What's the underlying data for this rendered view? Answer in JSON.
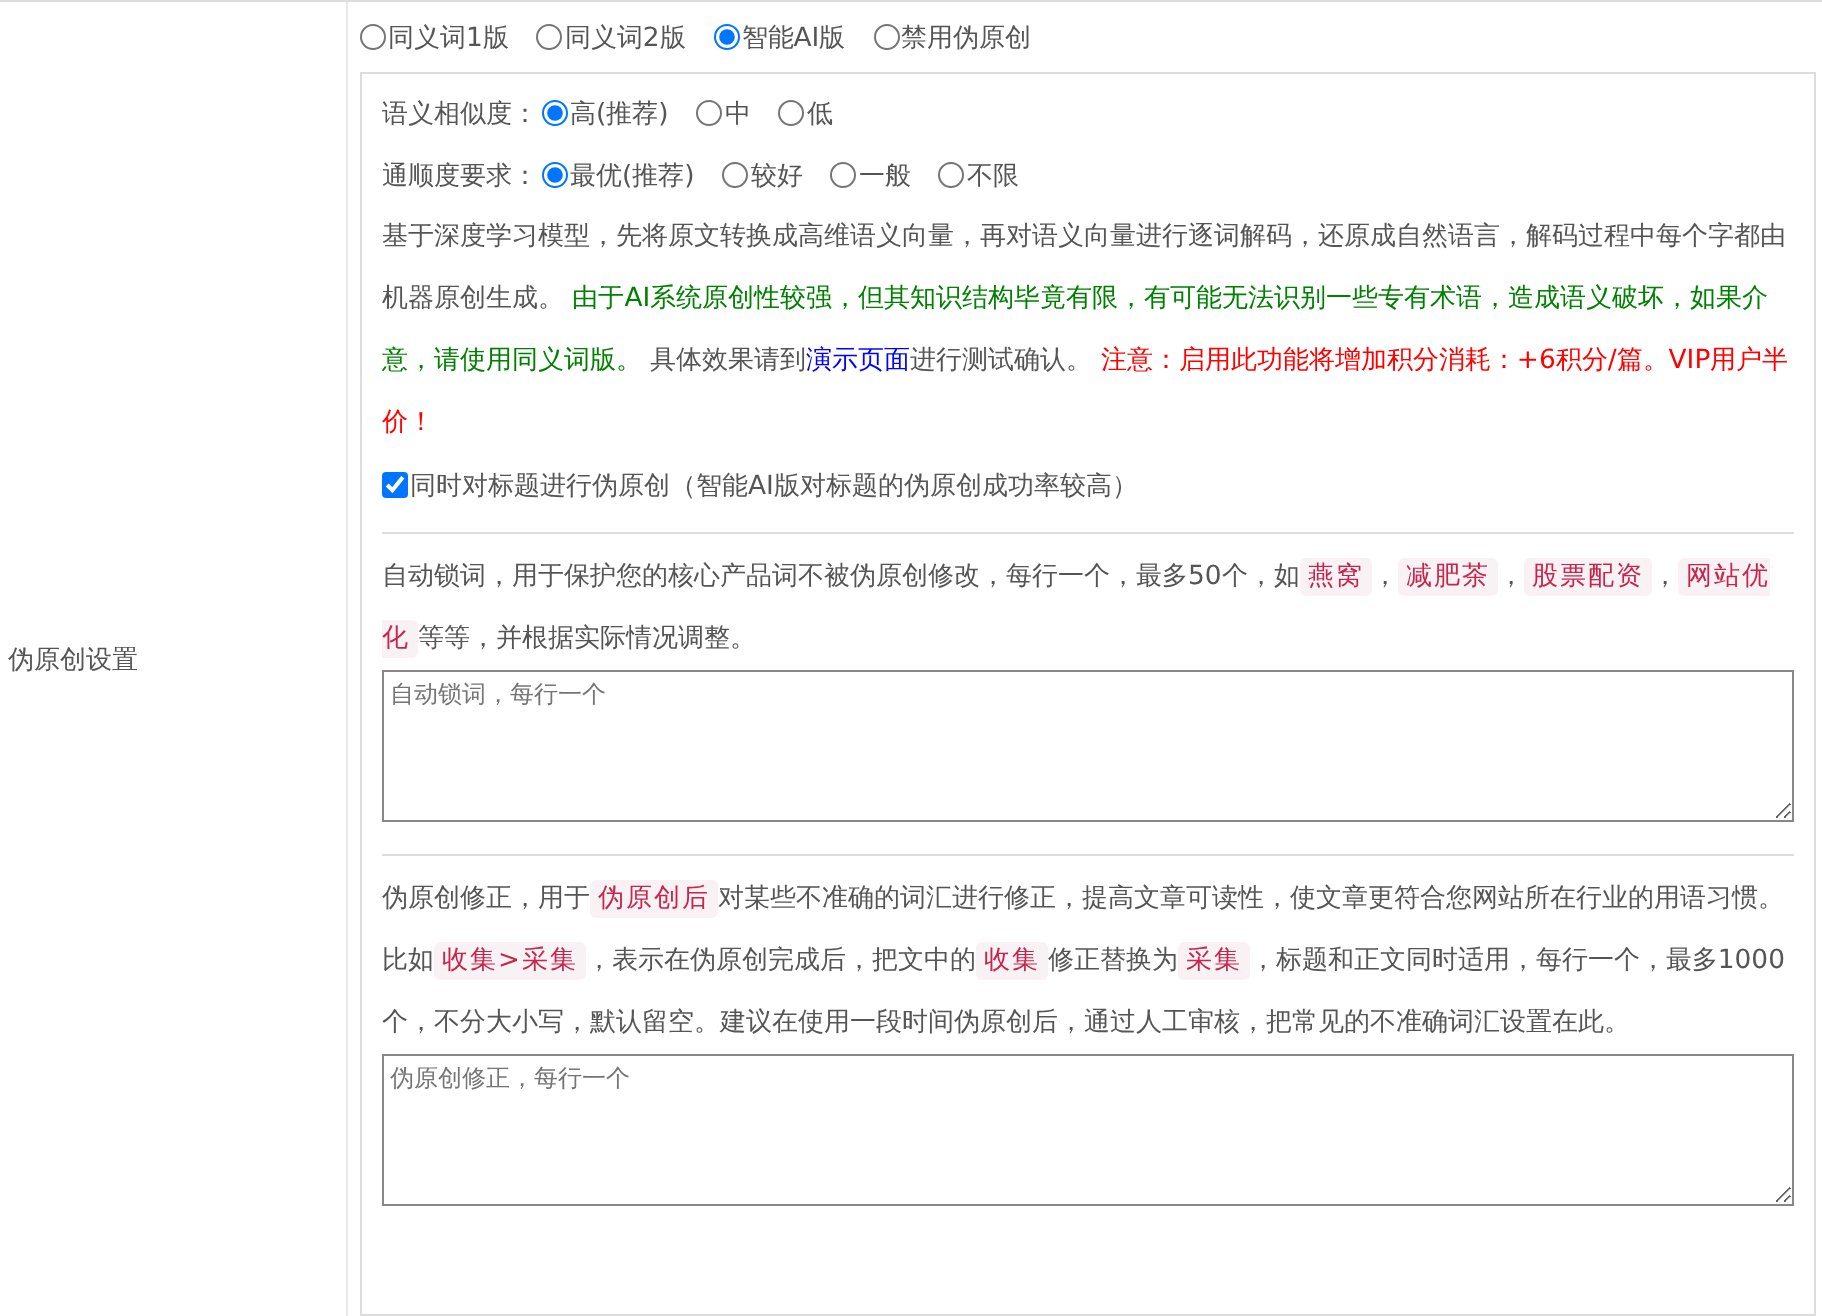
{
  "label": "伪原创设置",
  "modes": [
    {
      "label": "同义词1版",
      "selected": false
    },
    {
      "label": "同义词2版",
      "selected": false
    },
    {
      "label": "智能AI版",
      "selected": true
    },
    {
      "label": "禁用伪原创",
      "selected": false
    }
  ],
  "ai_panel": {
    "settings": [
      {
        "label": "语义相似度：",
        "options": [
          {
            "label": "高(推荐)",
            "selected": true
          },
          {
            "label": "中",
            "selected": false
          },
          {
            "label": "低",
            "selected": false
          }
        ]
      },
      {
        "label": "通顺度要求：",
        "options": [
          {
            "label": "最优(推荐)",
            "selected": true
          },
          {
            "label": "较好",
            "selected": false
          },
          {
            "label": "一般",
            "selected": false
          },
          {
            "label": "不限",
            "selected": false
          }
        ]
      }
    ],
    "description": [
      {
        "kind": "plain",
        "text": "基于深度学习模型，先将原文转换成高维语义向量，再对语义向量进行逐词解码，还原成自然语言，解码过程中每个字都由机器原创生成。 "
      },
      {
        "kind": "green",
        "text": "由于AI系统原创性较强，但其知识结构毕竟有限，有可能无法识别一些专有术语，造成语义破坏，如果介意，请使用同义词版。"
      },
      {
        "kind": "plain",
        "text": " 具体效果请到"
      },
      {
        "kind": "link",
        "text": "演示页面"
      },
      {
        "kind": "plain",
        "text": "进行测试确认。 "
      },
      {
        "kind": "red",
        "text": "注意：启用此功能将增加积分消耗：+6积分/篇。VIP用户半价！"
      }
    ],
    "title_option": {
      "label": "同时对标题进行伪原创（智能AI版对标题的伪原创成功率较高）",
      "checked": true
    }
  },
  "lock_words": {
    "description": [
      {
        "kind": "plain",
        "text": "自动锁词，用于保护您的核心产品词不被伪原创修改，每行一个，最多50个，如"
      },
      {
        "kind": "tag",
        "text": "燕窝"
      },
      {
        "kind": "plain",
        "text": "，"
      },
      {
        "kind": "tag",
        "text": "减肥茶"
      },
      {
        "kind": "plain",
        "text": "，"
      },
      {
        "kind": "tag",
        "text": "股票配资"
      },
      {
        "kind": "plain",
        "text": "，"
      },
      {
        "kind": "tag",
        "text": "网站优化"
      },
      {
        "kind": "plain",
        "text": "等等，并根据实际情况调整。"
      }
    ],
    "textarea": {
      "placeholder": "自动锁词，每行一个"
    }
  },
  "corrections": {
    "description": [
      {
        "kind": "plain",
        "text": "伪原创修正，用于"
      },
      {
        "kind": "tag",
        "text": "伪原创后"
      },
      {
        "kind": "plain",
        "text": "对某些不准确的词汇进行修正，提高文章可读性，使文章更符合您网站所在行业的用语习惯。比如"
      },
      {
        "kind": "tag",
        "text": "收集>采集"
      },
      {
        "kind": "plain",
        "text": "，表示在伪原创完成后，把文中的"
      },
      {
        "kind": "tag",
        "text": "收集"
      },
      {
        "kind": "plain",
        "text": "修正替换为"
      },
      {
        "kind": "tag",
        "text": "采集"
      },
      {
        "kind": "plain",
        "text": "，标题和正文同时适用，每行一个，最多1000个，不分大小写，默认留空。建议在使用一段时间伪原创后，通过人工审核，把常见的不准确词汇设置在此。"
      }
    ],
    "textarea": {
      "placeholder": "伪原创修正，每行一个"
    }
  }
}
